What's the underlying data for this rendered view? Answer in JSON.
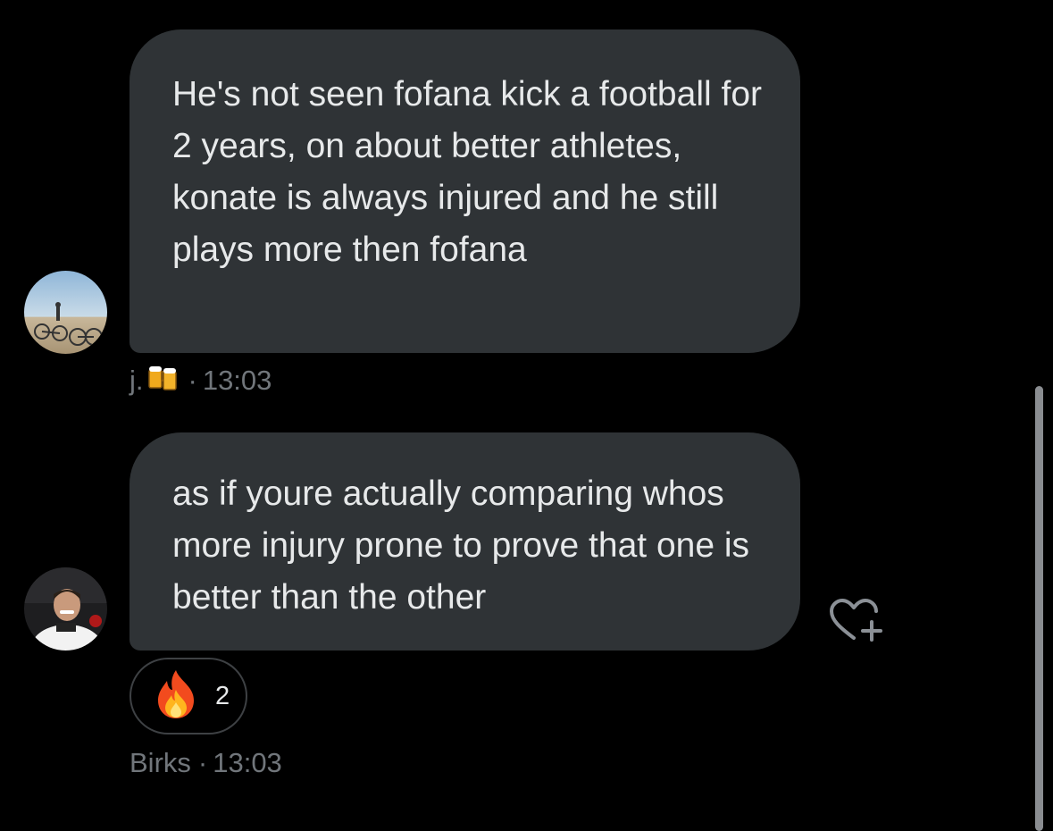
{
  "messages": [
    {
      "text": "He's not seen fofana kick a football for 2 years, on about better athletes, konate is always injured and he still plays more then fofana",
      "sender": "j.",
      "sender_emoji_icon": "beer-mugs-icon",
      "separator": "·",
      "time": "13:03"
    },
    {
      "text": "as if youre actually comparing whos more injury prone to prove that one is better than the other",
      "sender": "Birks",
      "separator": "·",
      "time": "13:03",
      "reaction": {
        "icon": "fire-icon",
        "count": "2"
      }
    }
  ],
  "colors": {
    "background": "#000000",
    "bubble": "#2f3336",
    "text": "#e7e9ea",
    "meta": "#71767b"
  }
}
